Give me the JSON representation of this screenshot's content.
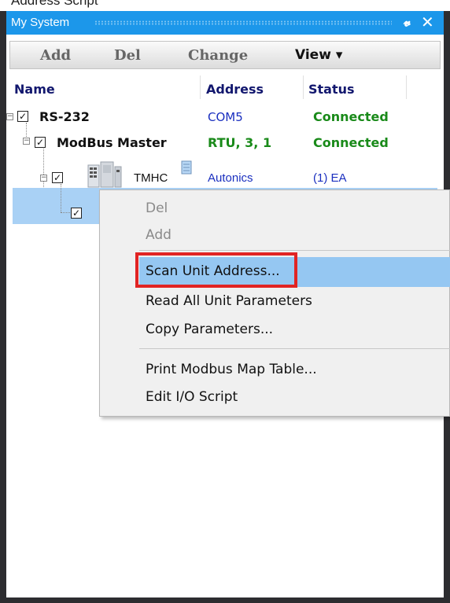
{
  "top_clip_text": "Address Script",
  "window": {
    "title": "My System",
    "pin_glyph": "⬍",
    "close_glyph": "✕"
  },
  "toolbar": {
    "add_label": "Add",
    "del_label": "Del",
    "change_label": "Change",
    "view_label": "View ▾"
  },
  "columns": {
    "name": "Name",
    "address": "Address",
    "status": "Status"
  },
  "tree": [
    {
      "name": "RS-232",
      "address": "COM5",
      "status": "Connected",
      "checked": "✓",
      "expander": "−"
    },
    {
      "name": "ModBus Master",
      "address": "RTU, 3, 1",
      "status": "Connected",
      "checked": "✓",
      "expander": "−"
    },
    {
      "name": "TMHC",
      "address": "Autonics",
      "status": "(1) EA",
      "checked": "✓",
      "expander": "−"
    },
    {
      "checked": "✓"
    }
  ],
  "context_menu": {
    "items": [
      {
        "label": "Del",
        "enabled": false
      },
      {
        "label": "Add",
        "enabled": false
      },
      {
        "label": "Scan Unit Address...",
        "highlighted": true
      },
      {
        "label": "Read All Unit Parameters"
      },
      {
        "label": "Copy Parameters..."
      },
      {
        "label": "Print Modbus Map Table..."
      },
      {
        "label": "Edit I/O Script"
      }
    ]
  },
  "colors": {
    "title_bar": "#1c97ea",
    "selection": "#a9d1f5",
    "menu_highlight": "#95c7f2",
    "red_highlight": "#e12424",
    "connected_green": "#198a19",
    "address_blue": "#1a2fbf",
    "header_navy": "#12176e"
  }
}
